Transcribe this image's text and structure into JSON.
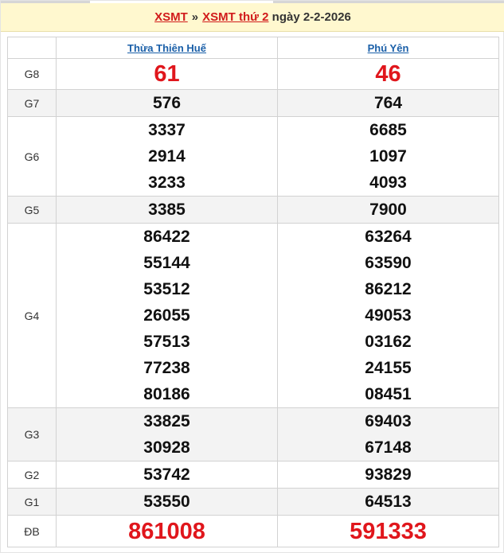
{
  "header": {
    "link1": "XSMT",
    "separator": "»",
    "link2": "XSMT thứ 2",
    "date_text": "ngày 2-2-2026"
  },
  "columns": [
    "Thừa Thiên Huế",
    "Phú Yên"
  ],
  "rows": [
    {
      "label": "G8",
      "col1": [
        "61"
      ],
      "col2": [
        "46"
      ]
    },
    {
      "label": "G7",
      "col1": [
        "576"
      ],
      "col2": [
        "764"
      ]
    },
    {
      "label": "G6",
      "col1": [
        "3337",
        "2914",
        "3233"
      ],
      "col2": [
        "6685",
        "1097",
        "4093"
      ]
    },
    {
      "label": "G5",
      "col1": [
        "3385"
      ],
      "col2": [
        "7900"
      ]
    },
    {
      "label": "G4",
      "col1": [
        "86422",
        "55144",
        "53512",
        "26055",
        "57513",
        "77238",
        "80186"
      ],
      "col2": [
        "63264",
        "63590",
        "86212",
        "49053",
        "03162",
        "24155",
        "08451"
      ]
    },
    {
      "label": "G3",
      "col1": [
        "33825",
        "30928"
      ],
      "col2": [
        "69403",
        "67148"
      ]
    },
    {
      "label": "G2",
      "col1": [
        "53742"
      ],
      "col2": [
        "93829"
      ]
    },
    {
      "label": "G1",
      "col1": [
        "53550"
      ],
      "col2": [
        "64513"
      ]
    },
    {
      "label": "ĐB",
      "col1": [
        "861008"
      ],
      "col2": [
        "591333"
      ]
    }
  ],
  "colors": {
    "header_bg": "#fff8cf",
    "header_link": "#d11b1b",
    "column_link": "#1a5fa8",
    "special_number": "#e0161c",
    "alt_row_bg": "#f3f3f3"
  }
}
